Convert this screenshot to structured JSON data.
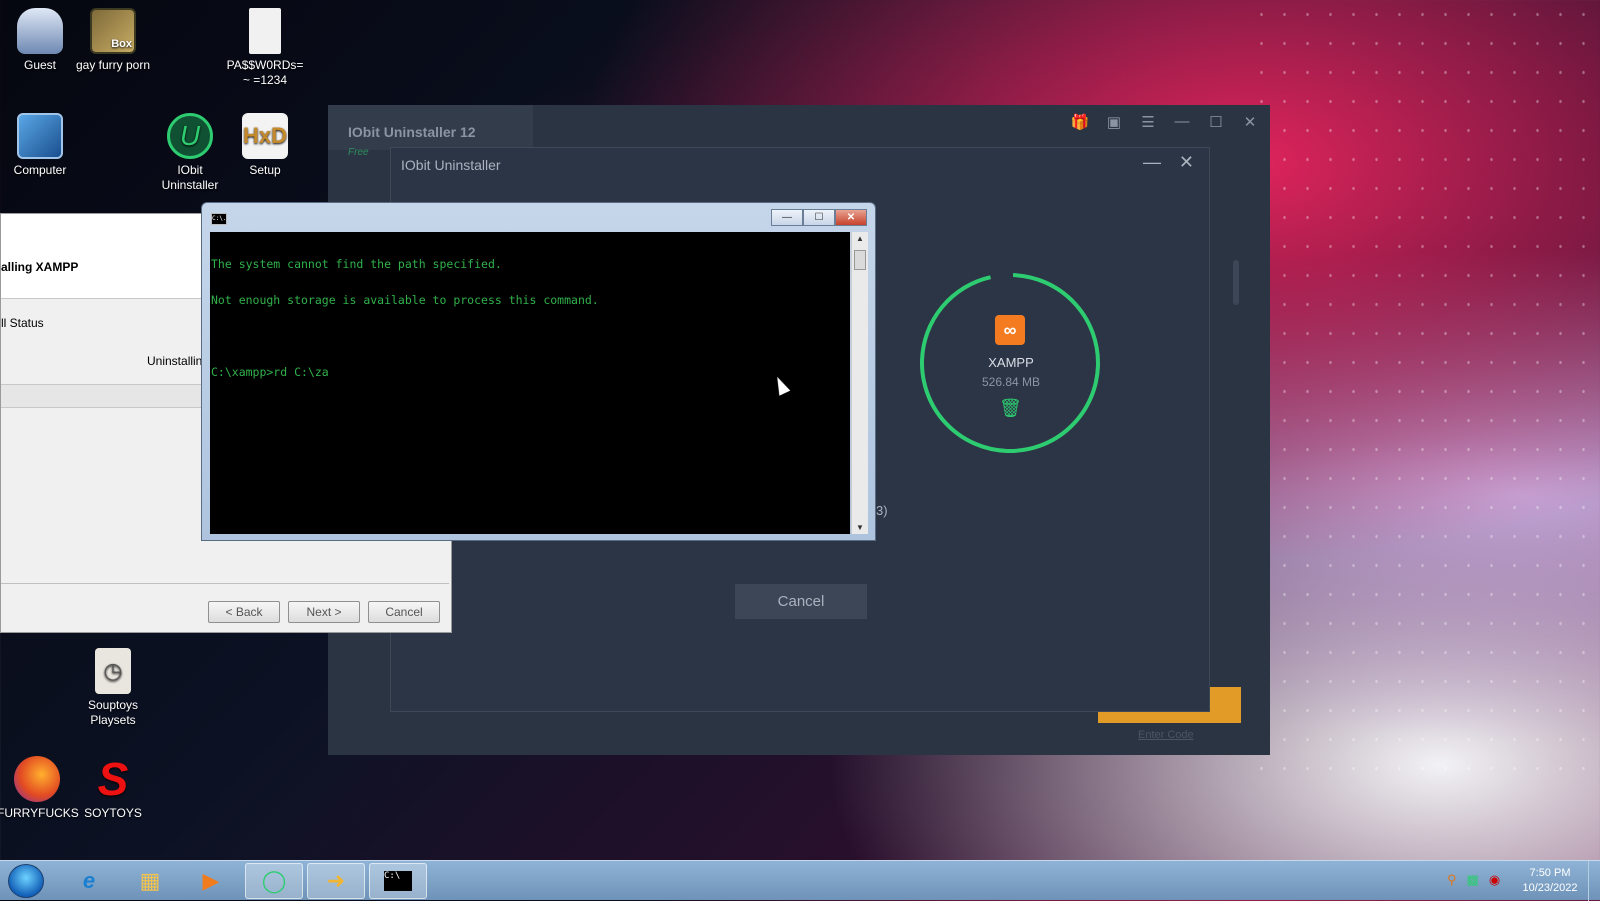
{
  "desktop": {
    "icons": [
      {
        "label": "Guest",
        "icon": "user-icon"
      },
      {
        "label": "gay furry porn",
        "icon": "box-game-icon",
        "badge": "Box"
      },
      {
        "label": "PA$$W0RDs= ~ =1234",
        "icon": "text-file-icon"
      },
      {
        "label": "Computer",
        "icon": "computer-icon"
      },
      {
        "label": "IObit Uninstaller",
        "icon": "iobit-icon",
        "glyph": "U"
      },
      {
        "label": "Setup",
        "icon": "hxd-icon",
        "glyph": "HxD"
      },
      {
        "label": "Souptoys Playsets",
        "icon": "souptoys-icon"
      },
      {
        "label": "FURRYFUCKS",
        "icon": "firefox-icon"
      },
      {
        "label": "SOYTOYS",
        "icon": "soytoys-icon",
        "glyph": "S"
      }
    ]
  },
  "iobit_main": {
    "title": "IObit Uninstaller 12",
    "edition": "Free",
    "enter_code": "Enter Code",
    "toolbar_icons": [
      "gift-icon",
      "briefcase-icon",
      "menu-icon",
      "minimize-icon",
      "maximize-icon",
      "close-icon"
    ]
  },
  "iobit_dialog": {
    "title": "IObit Uninstaller",
    "app_name": "XAMPP",
    "app_size": "526.84 MB",
    "stray_text": "3)",
    "cancel_label": "Cancel",
    "ring_color": "#2ecc71"
  },
  "installer": {
    "heading": "alling XAMPP",
    "status_label": "ll Status",
    "progress_text": "Uninstallin",
    "back_label": "< Back",
    "next_label": "Next >",
    "cancel_label": "Cancel"
  },
  "cmd": {
    "title_icon": "C:\\.",
    "lines": [
      "The system cannot find the path specified.",
      "Not enough storage is available to process this command.",
      "",
      "C:\\xampp>rd C:\\za"
    ],
    "text_color": "#30b14a"
  },
  "taskbar": {
    "items": [
      "start-orb-icon",
      "internet-explorer-icon",
      "folder-icon",
      "media-player-icon",
      "iobit-icon",
      "arrow-app-icon",
      "cmd-icon"
    ],
    "cmd_glyph": "C:\\",
    "time": "7:50 PM",
    "date": "10/23/2022",
    "tray_icons": [
      "search-icon",
      "network-icon",
      "security-icon"
    ]
  }
}
